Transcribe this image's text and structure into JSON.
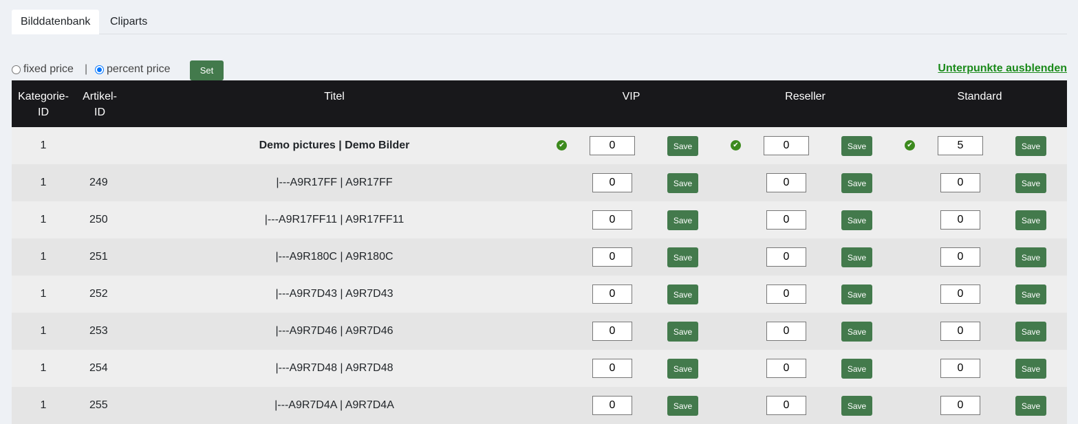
{
  "tabs": [
    {
      "label": "Bilddatenbank",
      "active": true
    },
    {
      "label": "Cliparts",
      "active": false
    }
  ],
  "controls": {
    "fixed_price_label": "fixed price",
    "separator": "|",
    "percent_price_label": "percent price",
    "selected_mode": "percent price",
    "set_label": "Set",
    "hide_link": "Unterpunkte ausblenden"
  },
  "table": {
    "headers": {
      "kategorie": "Kategorie-ID",
      "artikel": "Artikel-ID",
      "titel": "Titel",
      "vip": "VIP",
      "reseller": "Reseller",
      "standard": "Standard"
    },
    "save_label": "Save",
    "rows": [
      {
        "kat": "1",
        "art": "",
        "titel": "Demo pictures | Demo Bilder",
        "vip": "0",
        "reseller": "0",
        "standard": "5"
      },
      {
        "kat": "1",
        "art": "249",
        "titel": "|---A9R17FF | A9R17FF",
        "vip": "0",
        "reseller": "0",
        "standard": "0"
      },
      {
        "kat": "1",
        "art": "250",
        "titel": "|---A9R17FF11 | A9R17FF11",
        "vip": "0",
        "reseller": "0",
        "standard": "0"
      },
      {
        "kat": "1",
        "art": "251",
        "titel": "|---A9R180C | A9R180C",
        "vip": "0",
        "reseller": "0",
        "standard": "0"
      },
      {
        "kat": "1",
        "art": "252",
        "titel": "|---A9R7D43 | A9R7D43",
        "vip": "0",
        "reseller": "0",
        "standard": "0"
      },
      {
        "kat": "1",
        "art": "253",
        "titel": "|---A9R7D46 | A9R7D46",
        "vip": "0",
        "reseller": "0",
        "standard": "0"
      },
      {
        "kat": "1",
        "art": "254",
        "titel": "|---A9R7D48 | A9R7D48",
        "vip": "0",
        "reseller": "0",
        "standard": "0"
      },
      {
        "kat": "1",
        "art": "255",
        "titel": "|---A9R7D4A | A9R7D4A",
        "vip": "0",
        "reseller": "0",
        "standard": "0"
      }
    ]
  },
  "colors": {
    "accent_green": "#437a4c",
    "link_green": "#1a8a1a",
    "header_bg": "#18181b",
    "check_green": "#3c8a1d"
  }
}
